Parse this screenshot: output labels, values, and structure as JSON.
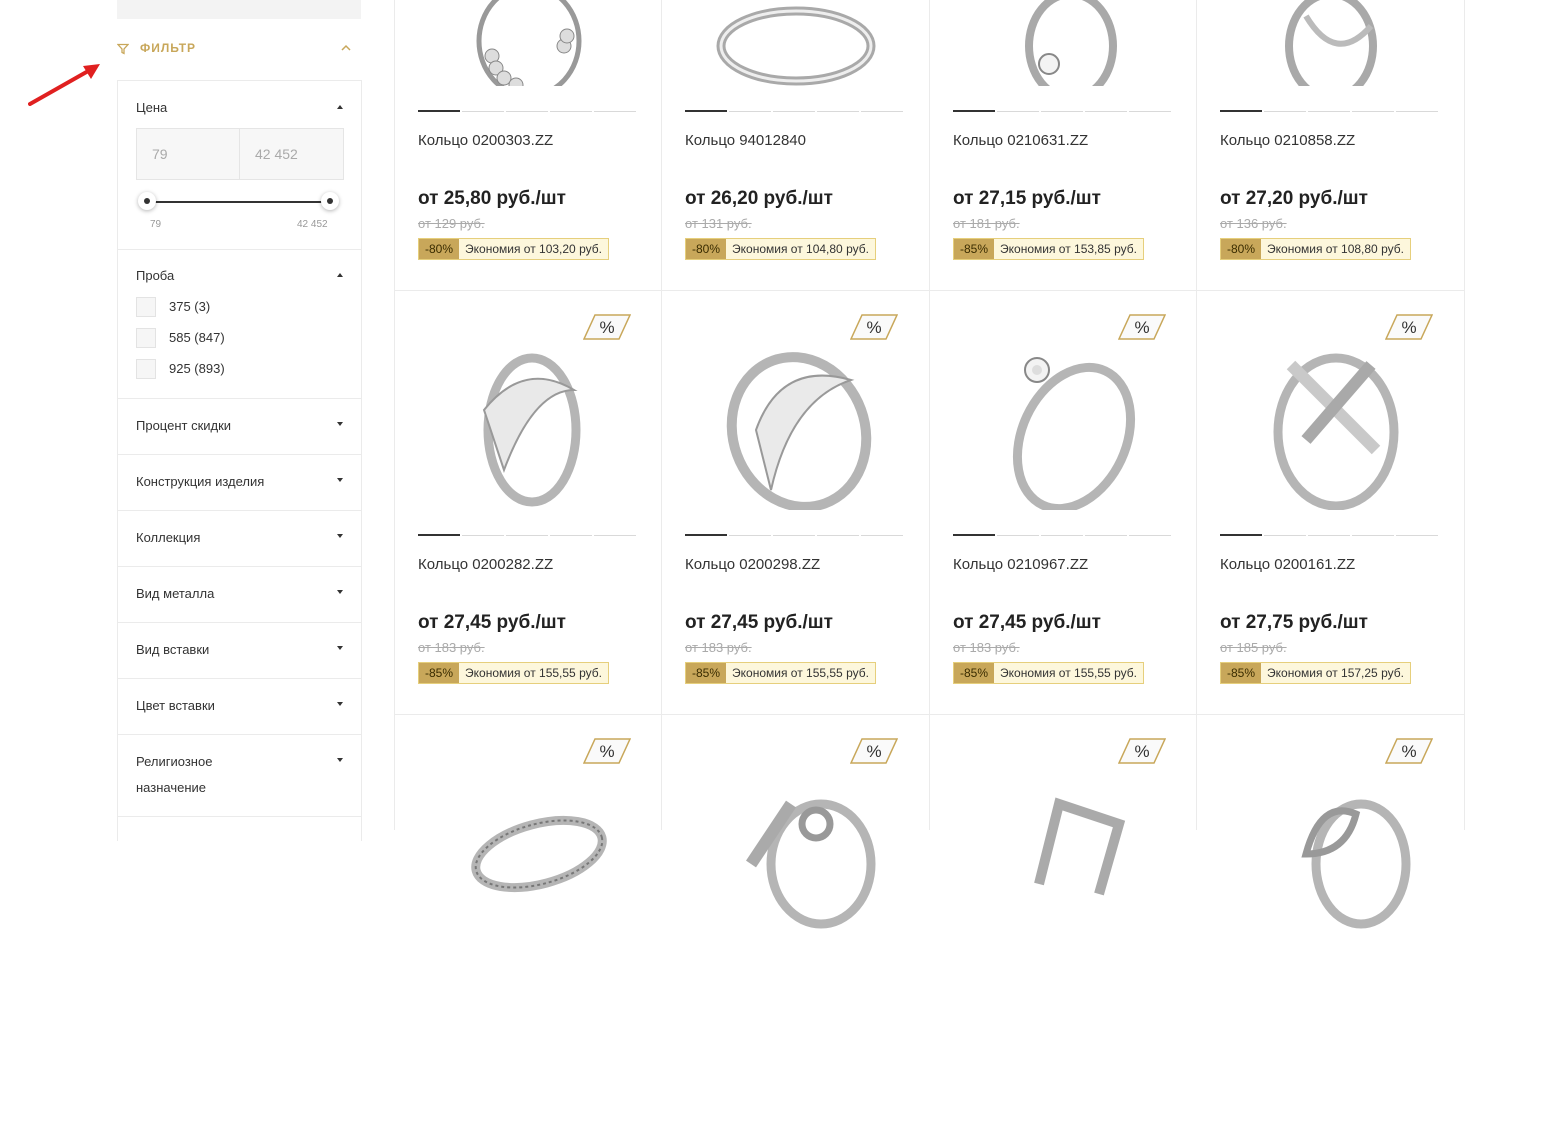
{
  "colors": {
    "accent": "#c8a75a",
    "arrow": "#e02020",
    "save_bg": "#fdf7dc"
  },
  "filter": {
    "title": "ФИЛЬТР",
    "price": {
      "title": "Цена",
      "min": "79",
      "max": "42 452",
      "min_label": "79",
      "max_label": "42 452"
    },
    "proba": {
      "title": "Проба",
      "options": [
        "375 (3)",
        "585 (847)",
        "925 (893)"
      ]
    },
    "sections": [
      "Процент скидки",
      "Конструкция изделия",
      "Коллекция",
      "Вид металла",
      "Вид вставки",
      "Цвет вставки",
      "Религиозное назначение"
    ]
  },
  "products": [
    {
      "name": "Кольцо 0200303.ZZ",
      "price": "от 25,80 руб./шт",
      "old": "от 129 руб.",
      "discount": "-80%",
      "saving": "Экономия от 103,20 руб."
    },
    {
      "name": "Кольцо 94012840",
      "price": "от 26,20 руб./шт",
      "old": "от 131 руб.",
      "discount": "-80%",
      "saving": "Экономия от 104,80 руб."
    },
    {
      "name": "Кольцо 0210631.ZZ",
      "price": "от 27,15 руб./шт",
      "old": "от 181 руб.",
      "discount": "-85%",
      "saving": "Экономия от 153,85 руб."
    },
    {
      "name": "Кольцо 0210858.ZZ",
      "price": "от 27,20 руб./шт",
      "old": "от 136 руб.",
      "discount": "-80%",
      "saving": "Экономия от 108,80 руб."
    },
    {
      "name": "Кольцо 0200282.ZZ",
      "price": "от 27,45 руб./шт",
      "old": "от 183 руб.",
      "discount": "-85%",
      "saving": "Экономия от 155,55 руб."
    },
    {
      "name": "Кольцо 0200298.ZZ",
      "price": "от 27,45 руб./шт",
      "old": "от 183 руб.",
      "discount": "-85%",
      "saving": "Экономия от 155,55 руб."
    },
    {
      "name": "Кольцо 0210967.ZZ",
      "price": "от 27,45 руб./шт",
      "old": "от 183 руб.",
      "discount": "-85%",
      "saving": "Экономия от 155,55 руб."
    },
    {
      "name": "Кольцо 0200161.ZZ",
      "price": "от 27,75 руб./шт",
      "old": "от 185 руб.",
      "discount": "-85%",
      "saving": "Экономия от 157,25 руб."
    }
  ],
  "badge_symbol": "%"
}
